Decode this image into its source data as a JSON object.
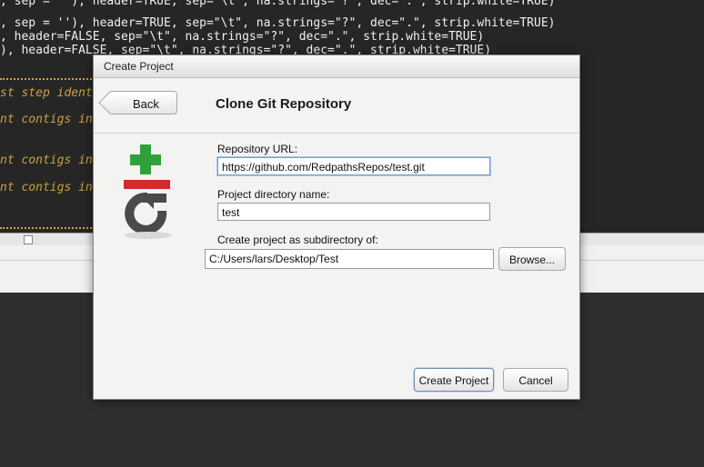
{
  "editor": {
    "lines": [
      ", sep = ''), header=TRUE, sep=\"\\t\", na.strings=\"?\", dec=\".\", strip.white=TRUE)",
      "p = ''), header=TRUE, sep=\"\\t\", na.strings=\"?\", dec=\".\", strip.white=TRUE)",
      ", header=FALSE, sep=\"\\t\", na.strings=\"?\", dec=\".\", strip.white=TRUE)",
      "), header=FALSE, sep=\"\\t\", na.strings=\"?\", dec=\".\", strip.white=TRUE)"
    ],
    "comments": [
      "st step ident",
      "nt contigs in",
      "nt contigs in",
      "nt contigs in"
    ]
  },
  "dialog": {
    "window_title": "Create Project",
    "back_label": "Back",
    "heading": "Clone Git Repository",
    "repo_url_label": "Repository URL:",
    "repo_url_value": "https://github.com/RedpathsRepos/test.git",
    "dir_name_label": "Project directory name:",
    "dir_name_value": "test",
    "subdir_label": "Create project as subdirectory of:",
    "subdir_value": "C:/Users/lars/Desktop/Test",
    "browse_label": "Browse...",
    "create_label": "Create Project",
    "cancel_label": "Cancel"
  },
  "colors": {
    "plus_green": "#2fa13a",
    "minus_red": "#d42a2a",
    "git_gray": "#4a4a4a"
  },
  "icons": [
    "git-logo-icon",
    "back-arrow-icon"
  ]
}
